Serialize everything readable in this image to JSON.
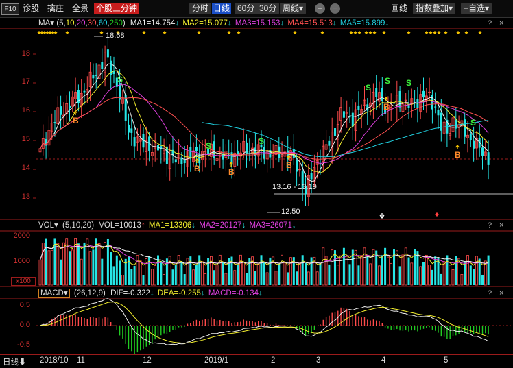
{
  "toolbar": {
    "f10": "F10",
    "left_tabs": [
      "诊股",
      "擒庄",
      "全景"
    ],
    "active_tab": "个股三分钟",
    "period_tabs": [
      "分时",
      "日线",
      "60分",
      "30分"
    ],
    "active_period": "日线",
    "weekly": "周线",
    "weekly_arrow": "▾",
    "plus": "+",
    "minus": "−",
    "draw": "画线",
    "overlay": "指数叠加",
    "overlay_arrow": "▾",
    "custom": "+自选",
    "custom_arrow": "▾"
  },
  "ma_legend": {
    "name": "MA",
    "arrow": "▾",
    "params_open": "(",
    "params": [
      "5",
      "10",
      "20",
      "30",
      "60",
      "250"
    ],
    "params_close": ")",
    "ma1": "MA1=14.754",
    "ma2": "MA2=15.077",
    "ma3": "MA3=15.153",
    "ma4": "MA4=15.513",
    "ma5": "MA5=15.899",
    "down": "↓"
  },
  "vol_legend": {
    "name": "VOL",
    "arrow": "▾",
    "params": "(5,10,20)",
    "vol": "VOL=10013",
    "ma1": "MA1=13306",
    "ma2": "MA2=20127",
    "ma3": "MA3=26071",
    "up": "↑",
    "down": "↓",
    "x100": "x100"
  },
  "macd_legend": {
    "name": "MACD",
    "arrow": "▾",
    "params": "(26,12,9)",
    "dif": "DIF=-0.322",
    "dea": "DEA=-0.255",
    "macd": "MACD=-0.134",
    "down": "↓"
  },
  "panel_controls": {
    "help": "?",
    "close": "×"
  },
  "price_axis": [
    "18",
    "17",
    "16",
    "15",
    "14",
    "13"
  ],
  "vol_axis": [
    "2000",
    "1000"
  ],
  "macd_axis": [
    "0.5",
    "0.0",
    "-0.5"
  ],
  "annotations": {
    "high": "18.68",
    "low": "12.50",
    "range": "13.16 - 13.19"
  },
  "signals": {
    "buy": "B",
    "sell": "S"
  },
  "x_axis": {
    "period": "日线",
    "period_arrow": "⬇",
    "labels": [
      "2018/10",
      "11",
      "12",
      "2019/1",
      "2",
      "3",
      "4",
      "5"
    ]
  },
  "colors": {
    "up": "#ff4b4b",
    "down": "#26e6e6",
    "ma1": "#f0f0f0",
    "ma2": "#f2ee2e",
    "ma3": "#e040e0",
    "ma4": "#ff5050",
    "ma5": "#20d0e0",
    "grid": "#9b1b1b"
  }
}
